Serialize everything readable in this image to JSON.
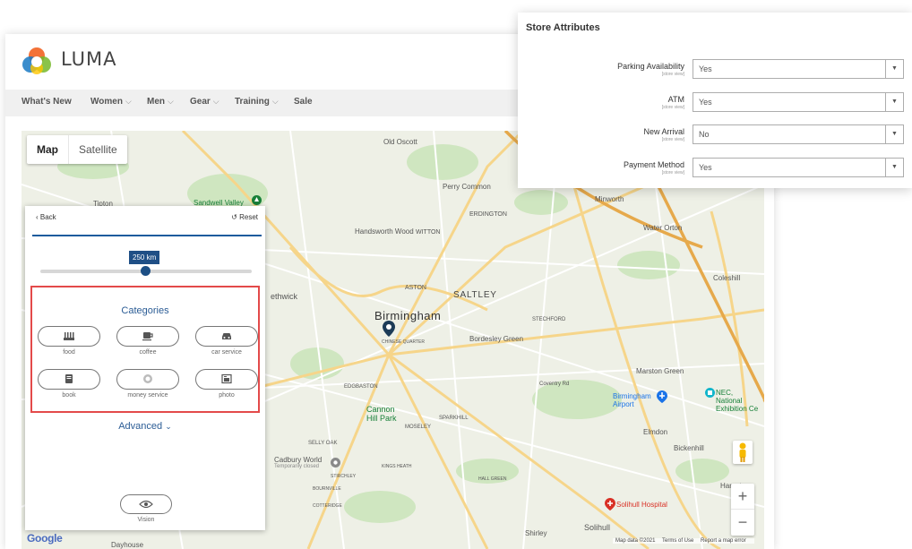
{
  "brand": {
    "logo_text": "LUMA",
    "colors": [
      "#f26322",
      "#1979c3",
      "#76b82a",
      "#ffc600"
    ]
  },
  "nav": {
    "items": [
      {
        "label": "What's New",
        "has_dropdown": false
      },
      {
        "label": "Women",
        "has_dropdown": true
      },
      {
        "label": "Men",
        "has_dropdown": true
      },
      {
        "label": "Gear",
        "has_dropdown": true
      },
      {
        "label": "Training",
        "has_dropdown": true
      },
      {
        "label": "Sale",
        "has_dropdown": false
      }
    ],
    "chevron": "⌵"
  },
  "map": {
    "type_buttons": {
      "map": "Map",
      "satellite": "Satellite"
    },
    "zoom_in": "+",
    "zoom_out": "−",
    "google": "Google",
    "attribution": {
      "data": "Map data ©2021",
      "terms": "Terms of Use",
      "report": "Report a map error"
    },
    "labels": {
      "old_oscott": "Old Oscott",
      "perry_common": "Perry Common",
      "minworth": "Minworth",
      "water_orton": "Water Orton",
      "sandwell_valley": "Sandwell Valley",
      "tipton": "Tipton",
      "handsworth_wood": "Handsworth Wood",
      "erdington": "ERDINGTON",
      "witton": "WITTON",
      "aston": "ASTON",
      "saltley": "SALTLEY",
      "birmingham": "Birmingham",
      "chinese_quarter": "CHINESE QUARTER",
      "bordesley_green": "Bordesley Green",
      "stechford": "STECHFORD",
      "coleshill": "Coleshill",
      "smethwick": "ethwick",
      "edgbaston": "EDGBASTON",
      "cannon_hill_park": "Cannon Hill Park",
      "sparkhill": "SPARKHILL",
      "moseley": "MOSELEY",
      "selly_oak": "SELLY OAK",
      "cadbury_world": "Cadbury World",
      "cadbury_note": "Temporarily closed",
      "kings_heath": "KINGS HEATH",
      "stirchley": "STIRCHLEY",
      "bournville": "BOURNVILLE",
      "cotteridge": "COTTERIDGE",
      "hall_green": "HALL GREEN",
      "marston_green": "Marston Green",
      "birmingham_airport": "Birmingham Airport",
      "nec": "NEC, National Exhibition Ce",
      "elmdon": "Elmdon",
      "bickenhill": "Bickenhill",
      "hampton": "Hampt",
      "solihull_hospital": "Solihull Hospital",
      "solihull": "Solihull",
      "shirley": "Shirley",
      "dayhouse": "Dayhouse",
      "coventry_rd": "Coventry Rd"
    }
  },
  "panel": {
    "back": "Back",
    "reset": "Reset",
    "radius": "250 km",
    "radius_fraction": 0.5,
    "categories_title": "Categories",
    "categories": [
      {
        "label": "food",
        "icon": "food-icon"
      },
      {
        "label": "coffee",
        "icon": "coffee-icon"
      },
      {
        "label": "car service",
        "icon": "car-icon"
      },
      {
        "label": "book",
        "icon": "book-icon"
      },
      {
        "label": "money service",
        "icon": "money-icon"
      },
      {
        "label": "photo",
        "icon": "photo-icon"
      }
    ],
    "advanced": "Advanced",
    "vision": "Vision"
  },
  "store_attributes": {
    "title": "Store Attributes",
    "rows": [
      {
        "name": "Parking Availability",
        "scope": "[store view]",
        "value": "Yes"
      },
      {
        "name": "ATM",
        "scope": "[store view]",
        "value": "Yes"
      },
      {
        "name": "New Arrival",
        "scope": "[store view]",
        "value": "No"
      },
      {
        "name": "Payment Method",
        "scope": "[store view]",
        "value": "Yes"
      }
    ]
  }
}
